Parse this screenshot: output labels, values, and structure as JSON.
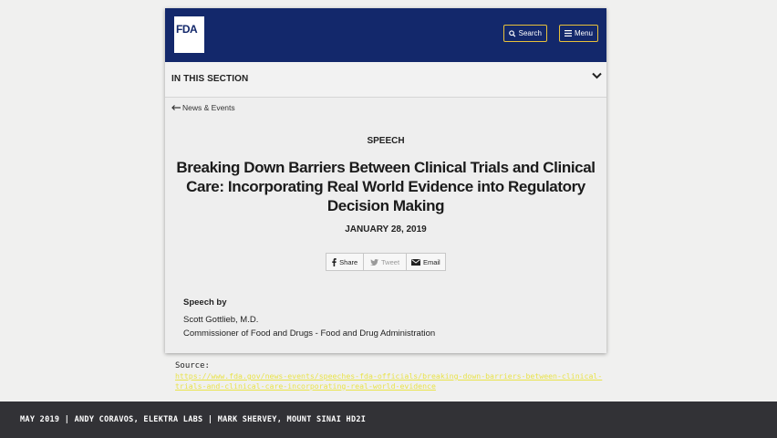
{
  "fda": {
    "logo_text": "FDA",
    "search_label": "Search",
    "menu_label": "Menu"
  },
  "section": {
    "title": "IN THIS SECTION"
  },
  "breadcrumb": {
    "back_label": "News & Events"
  },
  "article": {
    "kicker": "SPEECH",
    "title": "Breaking Down Barriers Between Clinical Trials and Clinical Care: Incorporating Real World Evidence into Regulatory Decision Making",
    "date": "JANUARY 28, 2019",
    "share_label": "Share",
    "tweet_label": "Tweet",
    "email_label": "Email",
    "speech_by_label": "Speech by",
    "author": "Scott Gottlieb, M.D.",
    "author_role": "Commissioner of Food and Drugs - Food and Drug Administration"
  },
  "source": {
    "label": "Source:",
    "url": "https://www.fda.gov/news-events/speeches-fda-officials/breaking-down-barriers-between-clinical-trials-and-clinical-care-incorporating-real-world-evidence"
  },
  "footer": {
    "text": "MAY 2019 | ANDY CORAVOS, ELEKTRA LABS | MARK SHERVEY, MOUNT SINAI HD2I"
  },
  "colors": {
    "fda_navy": "#13286b",
    "button_border": "#e8c13a",
    "link_yellow": "#e9e34a",
    "footer_bg": "#323236"
  },
  "icons": [
    "search-icon",
    "menu-icon",
    "chevron-down-icon",
    "arrow-left-icon",
    "facebook-icon",
    "twitter-icon",
    "email-icon"
  ]
}
